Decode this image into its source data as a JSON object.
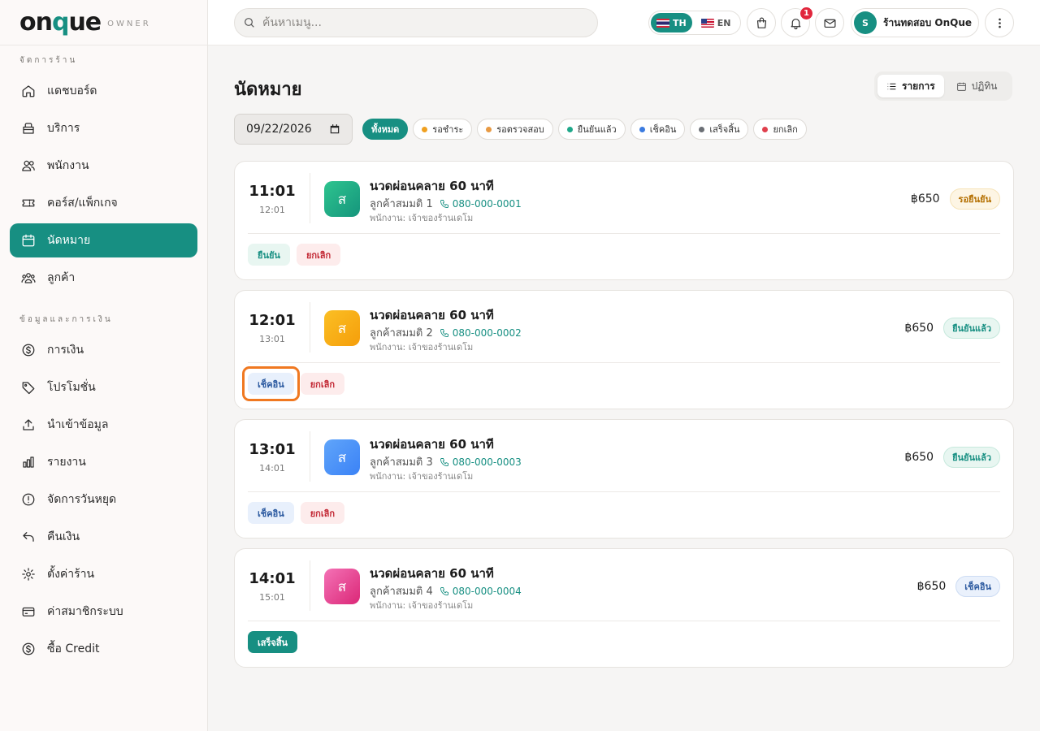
{
  "brand": {
    "logo_main": "on",
    "logo_q": "q",
    "logo_end": "ue",
    "tag": "OWNER"
  },
  "sidebar": {
    "section1": "จัดการร้าน",
    "section2": "ข้อมูลและการเงิน",
    "items": [
      {
        "label": "แดชบอร์ด",
        "icon": "home-icon"
      },
      {
        "label": "บริการ",
        "icon": "bag-icon"
      },
      {
        "label": "พนักงาน",
        "icon": "users-icon"
      },
      {
        "label": "คอร์ส/แพ็กเกจ",
        "icon": "ticket-icon"
      },
      {
        "label": "นัดหมาย",
        "icon": "calendar-icon",
        "active": true
      },
      {
        "label": "ลูกค้า",
        "icon": "group-icon"
      },
      {
        "label": "การเงิน",
        "icon": "dollar-icon"
      },
      {
        "label": "โปรโมชั่น",
        "icon": "tag-icon"
      },
      {
        "label": "นำเข้าข้อมูล",
        "icon": "upload-icon"
      },
      {
        "label": "รายงาน",
        "icon": "chart-icon"
      },
      {
        "label": "จัดการวันหยุด",
        "icon": "alert-icon"
      },
      {
        "label": "คืนเงิน",
        "icon": "undo-icon"
      },
      {
        "label": "ตั้งค่าร้าน",
        "icon": "gear-icon"
      },
      {
        "label": "ค่าสมาชิกระบบ",
        "icon": "card-icon"
      },
      {
        "label": "ซื้อ Credit",
        "icon": "dollar-icon"
      }
    ]
  },
  "header": {
    "search_placeholder": "ค้นหาเมนู...",
    "lang_th": "TH",
    "lang_en": "EN",
    "notification_count": "1",
    "account_initial": "S",
    "account_name": "ร้านทดสอบ OnQue"
  },
  "main": {
    "title": "นัดหมาย",
    "view_list": "รายการ",
    "view_calendar": "ปฏิทิน",
    "date_value": "09/22/2026",
    "filters": [
      {
        "label": "ทั้งหมด",
        "active": true
      },
      {
        "label": "รอชำระ",
        "dot": "#f0a020"
      },
      {
        "label": "รอตรวจสอบ",
        "dot": "#e89a44"
      },
      {
        "label": "ยืนยันแล้ว",
        "dot": "#1fa88a"
      },
      {
        "label": "เช็คอิน",
        "dot": "#3b7be0"
      },
      {
        "label": "เสร็จสิ้น",
        "dot": "#6b6f75"
      },
      {
        "label": "ยกเลิก",
        "dot": "#e0404d"
      }
    ],
    "appointments": [
      {
        "time": "11:01",
        "end": "12:01",
        "initial": "ส",
        "service": "นวดผ่อนคลาย 60 นาที",
        "customer": "ลูกค้าสมมติ 1",
        "phone": "080-000-0001",
        "staff": "พนักงาน: เจ้าของร้านเดโม",
        "price": "฿650",
        "status": "รอยืนยัน",
        "actions": [
          "ยืนยัน",
          "ยกเลิก"
        ]
      },
      {
        "time": "12:01",
        "end": "13:01",
        "initial": "ส",
        "service": "นวดผ่อนคลาย 60 นาที",
        "customer": "ลูกค้าสมมติ 2",
        "phone": "080-000-0002",
        "staff": "พนักงาน: เจ้าของร้านเดโม",
        "price": "฿650",
        "status": "ยืนยันแล้ว",
        "actions": [
          "เช็คอิน",
          "ยกเลิก"
        ]
      },
      {
        "time": "13:01",
        "end": "14:01",
        "initial": "ส",
        "service": "นวดผ่อนคลาย 60 นาที",
        "customer": "ลูกค้าสมมติ 3",
        "phone": "080-000-0003",
        "staff": "พนักงาน: เจ้าของร้านเดโม",
        "price": "฿650",
        "status": "ยืนยันแล้ว",
        "actions": [
          "เช็คอิน",
          "ยกเลิก"
        ]
      },
      {
        "time": "14:01",
        "end": "15:01",
        "initial": "ส",
        "service": "นวดผ่อนคลาย 60 นาที",
        "customer": "ลูกค้าสมมติ 4",
        "phone": "080-000-0004",
        "staff": "พนักงาน: เจ้าของร้านเดโม",
        "price": "฿650",
        "status": "เช็คอิน",
        "actions": [
          "เสร็จสิ้น"
        ]
      }
    ]
  },
  "colors": {
    "accent": "#178f82",
    "highlight": "#f07820"
  }
}
